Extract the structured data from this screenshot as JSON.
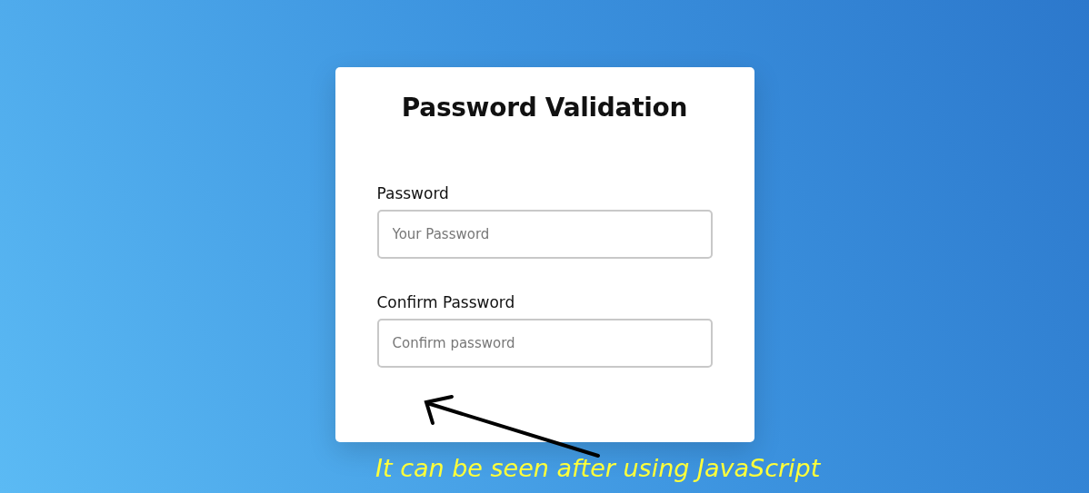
{
  "card": {
    "title": "Password Validation",
    "fields": [
      {
        "label": "Password",
        "placeholder": "Your Password"
      },
      {
        "label": "Confirm Password",
        "placeholder": "Confirm password"
      }
    ]
  },
  "annotation": {
    "text": "It can be seen after using JavaScript"
  }
}
